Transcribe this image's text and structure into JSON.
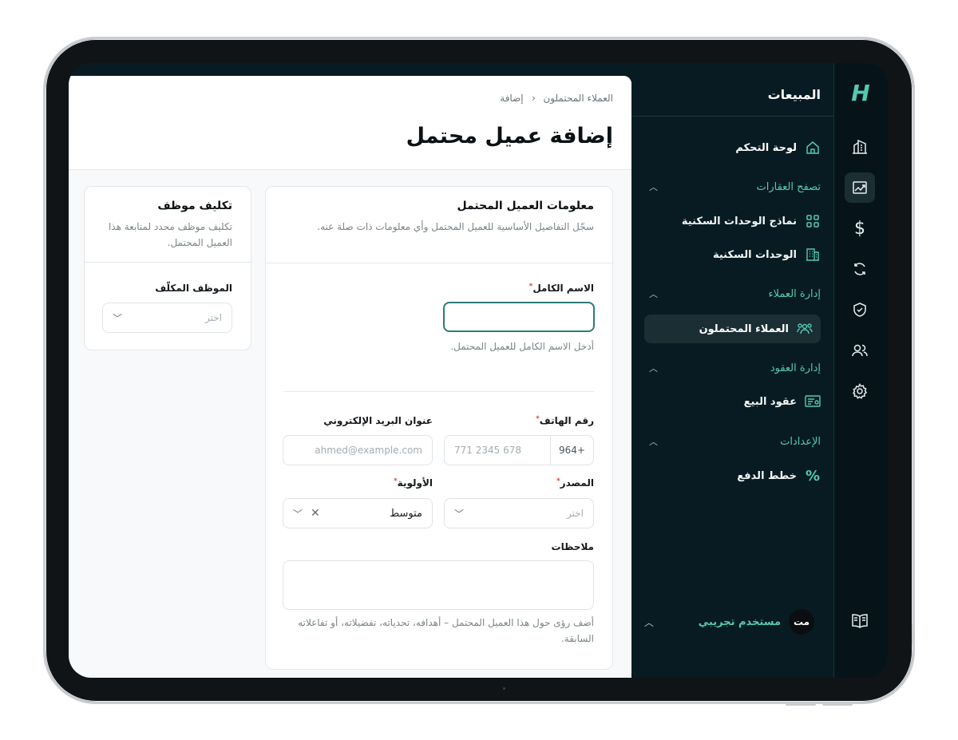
{
  "app": {
    "logo": "H",
    "section_title": "المبيعات"
  },
  "nav": {
    "dashboard": "لوحة التحكم",
    "browse_section": "تصفح العقارات",
    "unit_models": "نماذج الوحدات السكنية",
    "units": "الوحدات السكنية",
    "clients_section": "إدارة العملاء",
    "leads": "العملاء المحتملون",
    "contracts_section": "إدارة العقود",
    "sale_contracts": "عقود البيع",
    "settings_section": "الإعدادات",
    "payment_plans": "خطط الدفع"
  },
  "user": {
    "initials": "مت",
    "name": "مستخدم تجريبي"
  },
  "breadcrumb": {
    "parent": "العملاء المحتملون",
    "separator": "›",
    "current": "إضافة"
  },
  "page_title": "إضافة عميل محتمل",
  "lead_card": {
    "title": "معلومات العميل المحتمل",
    "description": "سجّل التفاصيل الأساسية للعميل المحتمل وأي معلومات ذات صلة عنه.",
    "full_name_label": "الاسم الكامل",
    "full_name_help": "أدخل الاسم الكامل للعميل المحتمل.",
    "phone_label": "رقم الهاتف",
    "phone_code": "+964",
    "phone_placeholder": "771 2345 678",
    "email_label": "عنوان البريد الإلكتروني",
    "email_placeholder": "ahmed@example.com",
    "source_label": "المصدر",
    "source_placeholder": "اختر",
    "priority_label": "الأولوية",
    "priority_value": "متوسط",
    "notes_label": "ملاحظات",
    "notes_help": "أضف رؤى حول هذا العميل المحتمل – أهدافه، تحدياته، تفضيلاته، أو تفاعلاته السابقة.",
    "required_mark": "*"
  },
  "assign_card": {
    "title": "تكليف موظف",
    "description": "تكليف موظف محدد لمتابعة هذا العميل المحتمل.",
    "employee_label": "الموظف المكلّف",
    "employee_placeholder": "اختر"
  },
  "colors": {
    "accent": "#53c9b2",
    "sidebar": "#081b22",
    "focus": "#2e7b77",
    "required": "#e0473f"
  }
}
